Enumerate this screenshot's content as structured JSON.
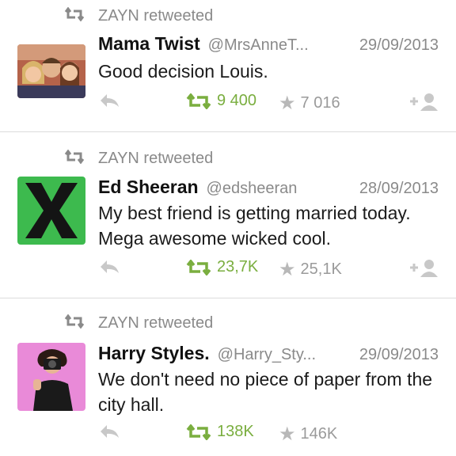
{
  "tweets": [
    {
      "retweeted_by": "ZAYN retweeted",
      "name": "Mama Twist",
      "handle": "@MrsAnneT...",
      "date": "29/09/2013",
      "text": "Good decision Louis.",
      "retweets": "9 400",
      "favorites": "7 016",
      "avatar_icon": "photo-group-avatar"
    },
    {
      "retweeted_by": "ZAYN retweeted",
      "name": "Ed Sheeran",
      "handle": "@edsheeran",
      "date": "28/09/2013",
      "text": "My best friend is getting married today. Mega awesome wicked cool.",
      "retweets": "23,7K",
      "favorites": "25,1K",
      "avatar_icon": "x-album-avatar"
    },
    {
      "retweeted_by": "ZAYN retweeted",
      "name": "Harry Styles.",
      "handle": "@Harry_Sty...",
      "date": "29/09/2013",
      "text": "We don't need no piece of paper from the city hall.",
      "retweets": "138K",
      "favorites": "146K",
      "avatar_icon": "camera-photo-avatar"
    }
  ],
  "colors": {
    "retweet_green": "#7aae3f",
    "muted_gray": "#8a8a8a",
    "ed_green": "#3dba4e",
    "harry_pink": "#e98ad8"
  }
}
